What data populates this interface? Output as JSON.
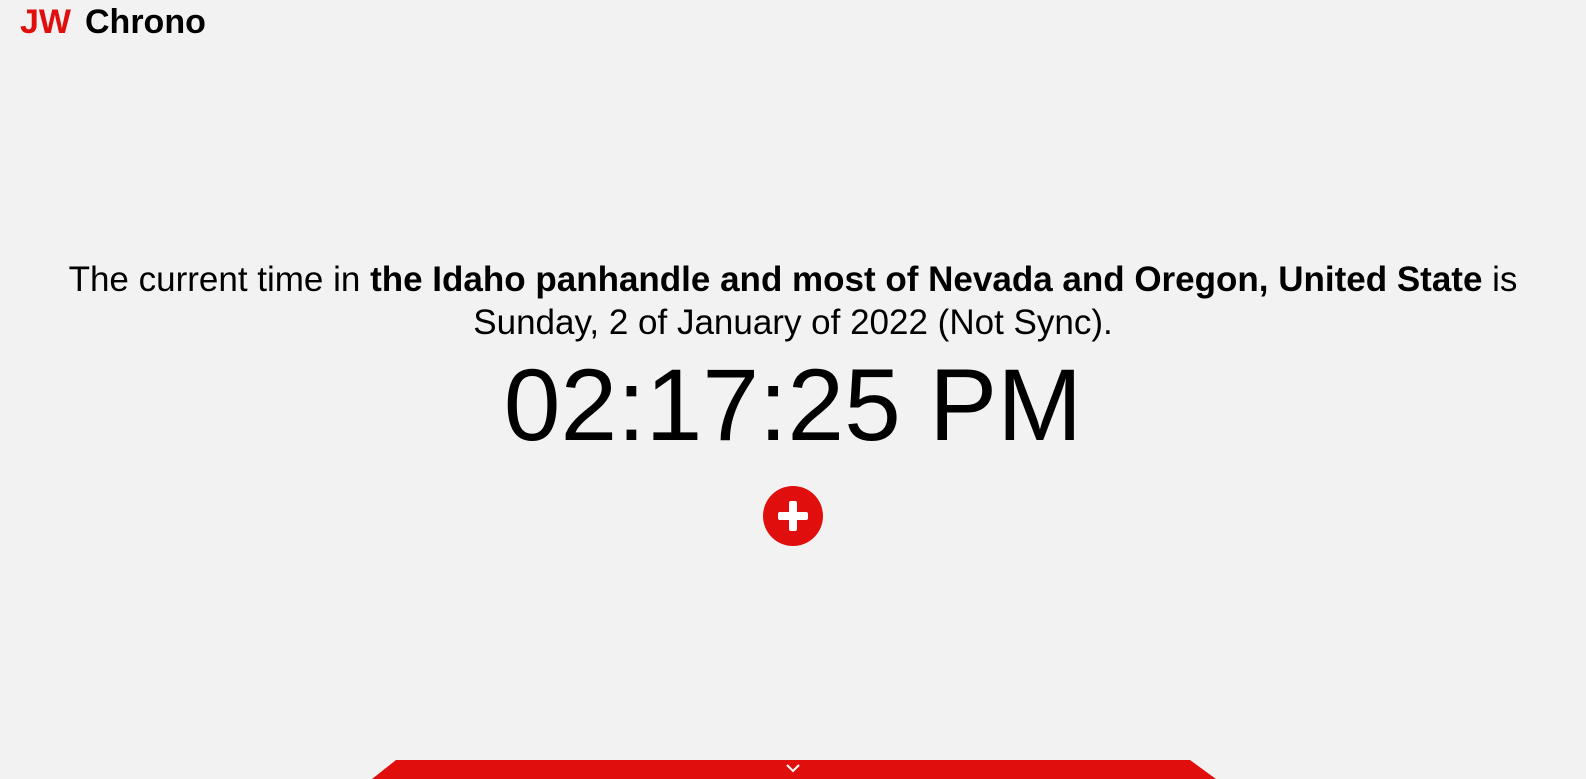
{
  "brand": {
    "prefix": "JW",
    "name": "Chrono"
  },
  "location_text": {
    "lead": "The current time in ",
    "place": "the Idaho panhandle and most of Nevada and Oregon, United State",
    "is": " is",
    "date": "Sunday, 2 of January of 2022 (Not Sync)."
  },
  "clock": {
    "time": "02:17:25 PM"
  },
  "icons": {
    "add": "plus-circle-icon",
    "drawer": "chevron-down-icon"
  },
  "colors": {
    "accent": "#e10e0e",
    "background": "#f2f2f2",
    "text": "#000000"
  }
}
